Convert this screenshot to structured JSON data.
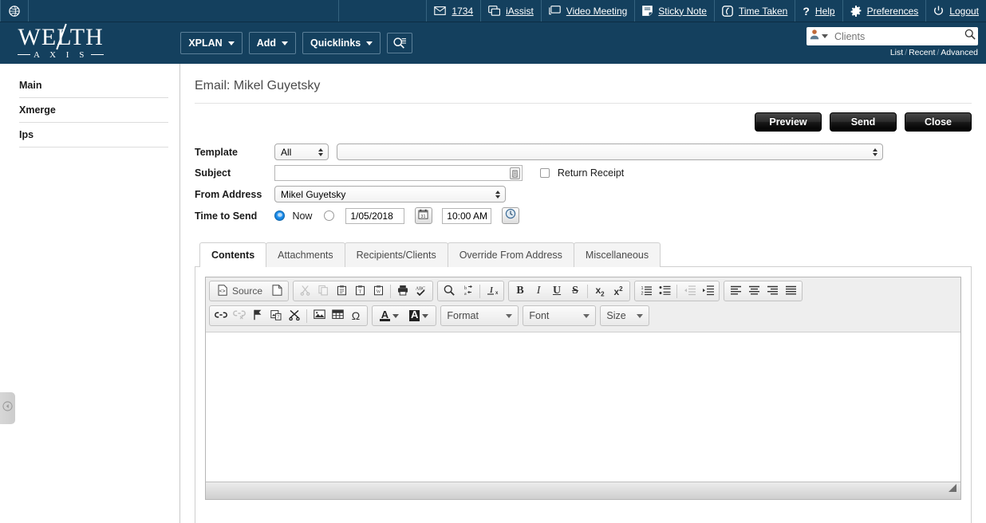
{
  "topbar": {
    "globe_icon": "globe-icon",
    "items": [
      {
        "icon": "envelope-icon",
        "label": "1734",
        "name": "mail-count"
      },
      {
        "icon": "iassist-icon",
        "label": "iAssist",
        "name": "iassist"
      },
      {
        "icon": "screen-icon",
        "label": "Video Meeting",
        "name": "video-meeting"
      },
      {
        "icon": "note-icon",
        "label": "Sticky Note",
        "name": "sticky-note"
      },
      {
        "icon": "timer-icon",
        "label": "Time Taken",
        "name": "time-taken"
      },
      {
        "icon": "question-icon",
        "label": "Help",
        "name": "help"
      },
      {
        "icon": "gear-icon",
        "label": "Preferences",
        "name": "preferences"
      },
      {
        "icon": "power-icon",
        "label": "Logout",
        "name": "logout"
      }
    ]
  },
  "brand": {
    "line1": "WE LTH",
    "line1_a": "WE",
    "line1_b": "LTH",
    "line2": "A X I S"
  },
  "nav": {
    "buttons": [
      {
        "label": "XPLAN",
        "name": "nav-xplan"
      },
      {
        "label": "Add",
        "name": "nav-add"
      },
      {
        "label": "Quicklinks",
        "name": "nav-quicklinks"
      }
    ],
    "search_icon": "search-list-icon"
  },
  "search": {
    "scope_icon": "person-icon",
    "placeholder": "Clients",
    "value": "",
    "links": {
      "list": "List",
      "recent": "Recent",
      "advanced": "Advanced"
    }
  },
  "sidebar": {
    "items": [
      {
        "label": "Main",
        "name": "sidebar-item-main"
      },
      {
        "label": "Xmerge",
        "name": "sidebar-item-xmerge"
      },
      {
        "label": "Ips",
        "name": "sidebar-item-ips"
      }
    ],
    "collapse_icon": "collapse-left-icon"
  },
  "page": {
    "title": "Email: Mikel Guyetsky"
  },
  "actions": {
    "preview": "Preview",
    "send": "Send",
    "close": "Close"
  },
  "form": {
    "template_label": "Template",
    "template_scope_value": "All",
    "template_value": "",
    "subject_label": "Subject",
    "subject_value": "",
    "return_receipt_label": "Return Receipt",
    "from_label": "From Address",
    "from_value": "Mikel Guyetsky",
    "time_label": "Time to Send",
    "now_label": "Now",
    "date_value": "1/05/2018",
    "time_value": "10:00 AM",
    "calendar_icon": "calendar-icon",
    "clock_icon": "clock-icon"
  },
  "tabs": [
    {
      "label": "Contents",
      "name": "tab-contents",
      "active": true
    },
    {
      "label": "Attachments",
      "name": "tab-attachments",
      "active": false
    },
    {
      "label": "Recipients/Clients",
      "name": "tab-recipients-clients",
      "active": false
    },
    {
      "label": "Override From Address",
      "name": "tab-override-from-address",
      "active": false
    },
    {
      "label": "Miscellaneous",
      "name": "tab-miscellaneous",
      "active": false
    }
  ],
  "editor": {
    "source_label": "Source",
    "format_label": "Format",
    "font_label": "Font",
    "size_label": "Size",
    "content": "",
    "toolbar_icons_row1": [
      "source-icon",
      "new-page-icon",
      "cut-icon",
      "copy-icon",
      "paste-icon",
      "paste-text-icon",
      "paste-word-icon",
      "print-icon",
      "spellcheck-icon",
      "find-icon",
      "replace-icon",
      "remove-format-icon",
      "bold-icon",
      "italic-icon",
      "underline-icon",
      "strikethrough-icon",
      "subscript-icon",
      "superscript-icon",
      "numbered-list-icon",
      "bulleted-list-icon",
      "outdent-icon",
      "indent-icon",
      "align-left-icon",
      "align-center-icon",
      "align-right-icon",
      "justify-icon"
    ],
    "toolbar_icons_row2": [
      "link-icon",
      "unlink-icon",
      "anchor-icon",
      "image-placeholder-icon",
      "scissors-icon",
      "image-icon",
      "table-icon",
      "special-char-icon",
      "text-color-icon",
      "background-color-icon"
    ]
  },
  "colors": {
    "brand_navy": "#14405e",
    "accent_blue": "#1b8cec",
    "border_gray": "#cfcfcf"
  }
}
